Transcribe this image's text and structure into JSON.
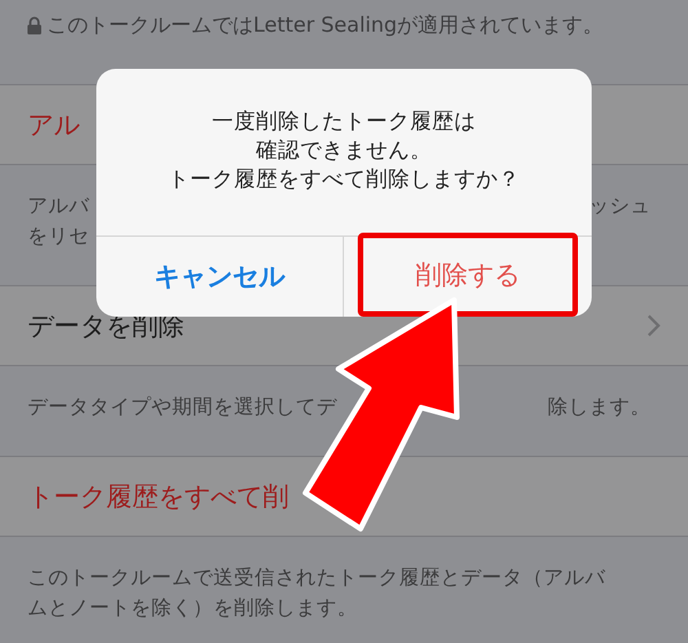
{
  "notice": {
    "text": "このトークルームではLetter Sealingが適用されています。"
  },
  "sections": [
    {
      "kind": "danger",
      "title": "アル",
      "lines": [
        {
          "left": "アルバ",
          "right": "ッシュ"
        },
        {
          "left": "をリセ"
        }
      ]
    },
    {
      "kind": "link",
      "title": "データを削除",
      "lines": [
        {
          "left": "データタイプや期間を選択してデ",
          "right": "除します。"
        }
      ]
    },
    {
      "kind": "danger",
      "title": "トーク履歴をすべて削",
      "lines": [
        {
          "left": "このトークルームで送受信されたトーク履歴とデータ（アルバ"
        },
        {
          "left": "ムとノートを除く）を削除します。"
        }
      ]
    }
  ],
  "dialog": {
    "message_lines": [
      "一度削除したトーク履歴は",
      "確認できません。",
      "トーク履歴をすべて削除しますか？"
    ],
    "buttons": [
      {
        "label": "キャンセル",
        "kind": "cancel",
        "highlighted": false
      },
      {
        "label": "削除する",
        "kind": "destructive",
        "highlighted": true
      }
    ]
  }
}
